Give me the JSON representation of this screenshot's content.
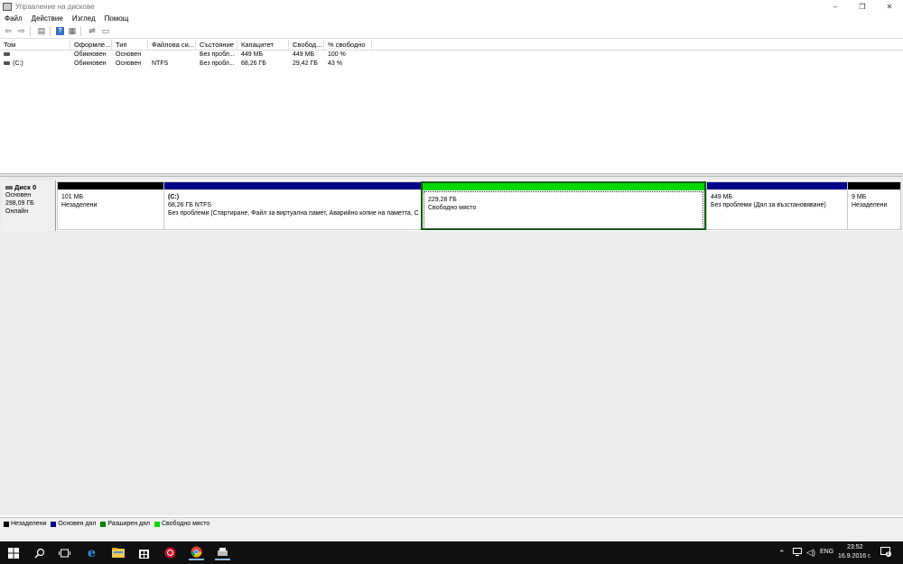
{
  "window": {
    "title": "Управление на дискове",
    "controls": [
      "–",
      "❐",
      "✕"
    ]
  },
  "menu": [
    "Файл",
    "Действие",
    "Изглед",
    "Помощ"
  ],
  "volume_list": {
    "columns": [
      "Том",
      "Оформле...",
      "Тип",
      "Файлова си...",
      "Състояние",
      "Капацитет",
      "Свобод...",
      "% свободно"
    ],
    "rows": [
      [
        "",
        "Обикновен",
        "Основен",
        "",
        "Без пробл...",
        "449 МБ",
        "449 МБ",
        "100 %"
      ],
      [
        "(C:)",
        "Обикновен",
        "Основен",
        "NTFS",
        "Без пробл...",
        "68,26 ГБ",
        "29,42 ГБ",
        "43 %"
      ]
    ]
  },
  "disk": {
    "name": "Диск 0",
    "type": "Основен",
    "size": "298,09 ГБ",
    "status": "Онлайн",
    "partitions": [
      {
        "name": "",
        "size": "101 МБ",
        "status": "Незаделени",
        "color": "#000000"
      },
      {
        "name": "(C:)",
        "size": "68,26 ГБ NTFS",
        "status": "Без проблеми (Стартиране, Файл за виртуална памет, Аварийно копие на паметта, О",
        "color": "#00008b"
      },
      {
        "name": "",
        "size": "229,28 ГБ",
        "status": "Свободно място",
        "color": "#00d800"
      },
      {
        "name": "",
        "size": "449 МБ",
        "status": "Без проблеми (Дял за възстановяване)",
        "color": "#00008b"
      },
      {
        "name": "",
        "size": "9 МБ",
        "status": "Незаделени",
        "color": "#000000"
      }
    ]
  },
  "legend": [
    {
      "label": "Незаделени",
      "color": "#000000"
    },
    {
      "label": "Основен дял",
      "color": "#00008b"
    },
    {
      "label": "Разширен дял",
      "color": "#008000"
    },
    {
      "label": "Свободно място",
      "color": "#00d800"
    }
  ],
  "taskbar": {
    "language": "ENG",
    "time": "23:52",
    "date": "16.9.2016 г.",
    "notifications": "1"
  }
}
